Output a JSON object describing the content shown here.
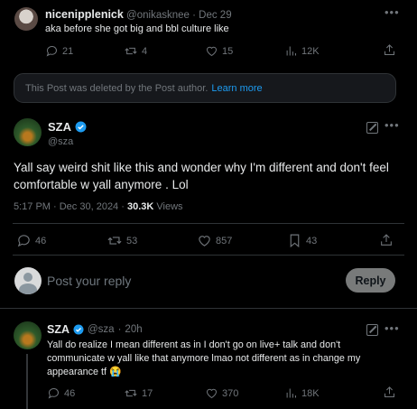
{
  "colors": {
    "bg": "#000000",
    "text": "#e7e9ea",
    "muted": "#71767b",
    "accent": "#1d9bf0",
    "verified": "#1d9bf0",
    "border": "#2f3336"
  },
  "post1": {
    "name": "nicenipplenick",
    "handle": "@onikasknee",
    "sep": "·",
    "date": "Dec 29",
    "text": "aka before she got big and bbl culture like",
    "stats": {
      "replies": "21",
      "reposts": "4",
      "likes": "15",
      "views": "12K"
    }
  },
  "deleted": {
    "text": "This Post was deleted by the Post author.",
    "link": "Learn more"
  },
  "main_post": {
    "name": "SZA",
    "handle": "@sza",
    "text": "Yall say weird shit like this and wonder why I'm different and don't feel comfortable w yall anymore . Lol",
    "time": "5:17 PM · Dec 30, 2024 ·",
    "views_count": "30.3K",
    "views_label": "Views",
    "stats": {
      "replies": "46",
      "reposts": "53",
      "likes": "857",
      "bookmarks": "43"
    }
  },
  "reply_box": {
    "placeholder": "Post your reply",
    "button": "Reply"
  },
  "reply_post": {
    "name": "SZA",
    "handle": "@sza",
    "sep": "·",
    "date": "20h",
    "text": "Yall do realize I mean different as in I don't go on live+ talk and don't communicate w yall like that anymore lmao not different as in change my appearance tf 😭",
    "stats": {
      "replies": "46",
      "reposts": "17",
      "likes": "370",
      "views": "18K"
    }
  },
  "icons": [
    "more-icon",
    "reply-icon",
    "repost-icon",
    "like-icon",
    "views-icon",
    "share-icon",
    "bookmark-icon",
    "grok-icon",
    "verified-icon"
  ]
}
